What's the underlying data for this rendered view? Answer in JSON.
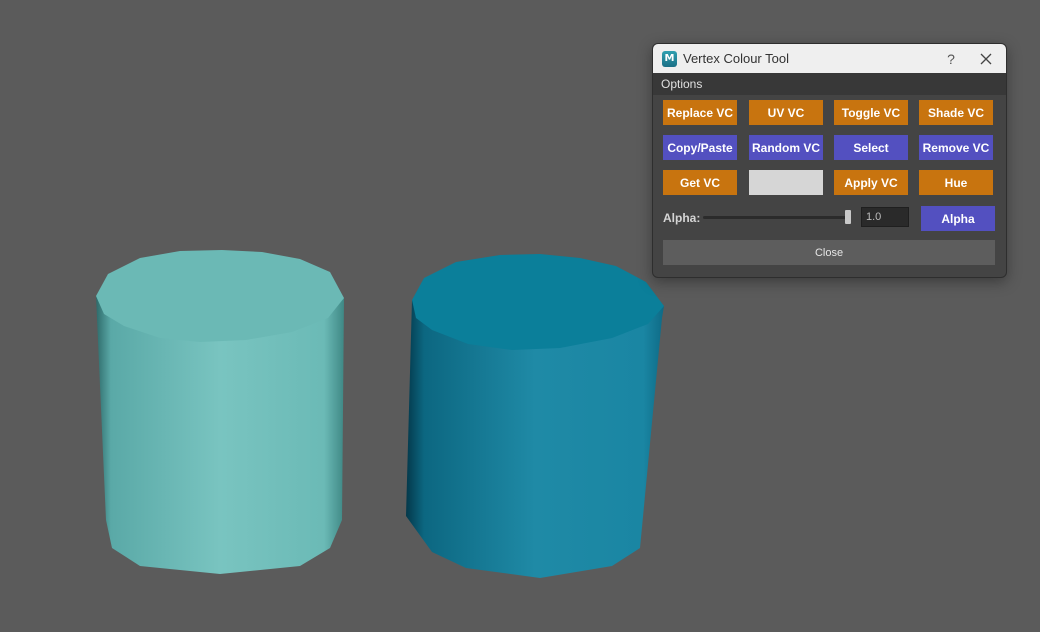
{
  "scene": {
    "colors": {
      "background": "#5b5b5b",
      "cylinder_left": "#6fc0bd",
      "cylinder_right": "#137f99"
    }
  },
  "window": {
    "title": "Vertex Colour Tool",
    "app_icon_letter": "M",
    "help_label": "?",
    "icons": {
      "app": "maya-app-icon",
      "close": "close-icon"
    }
  },
  "menubar": {
    "options": "Options"
  },
  "buttons": {
    "replace_vc": "Replace VC",
    "uv_vc": "UV VC",
    "toggle_vc": "Toggle VC",
    "shade_vc": "Shade VC",
    "copy_paste": "Copy/Paste",
    "random_vc": "Random VC",
    "select": "Select",
    "remove_vc": "Remove VC",
    "get_vc": "Get VC",
    "apply_vc": "Apply VC",
    "hue": "Hue",
    "alpha": "Alpha",
    "close": "Close"
  },
  "colors": {
    "orange_button": "#c8740f",
    "purple_button": "#5350c0",
    "color_swatch": "#d6d6d6"
  },
  "alpha": {
    "label": "Alpha:",
    "value": "1.0",
    "slider_fraction": 1.0
  }
}
